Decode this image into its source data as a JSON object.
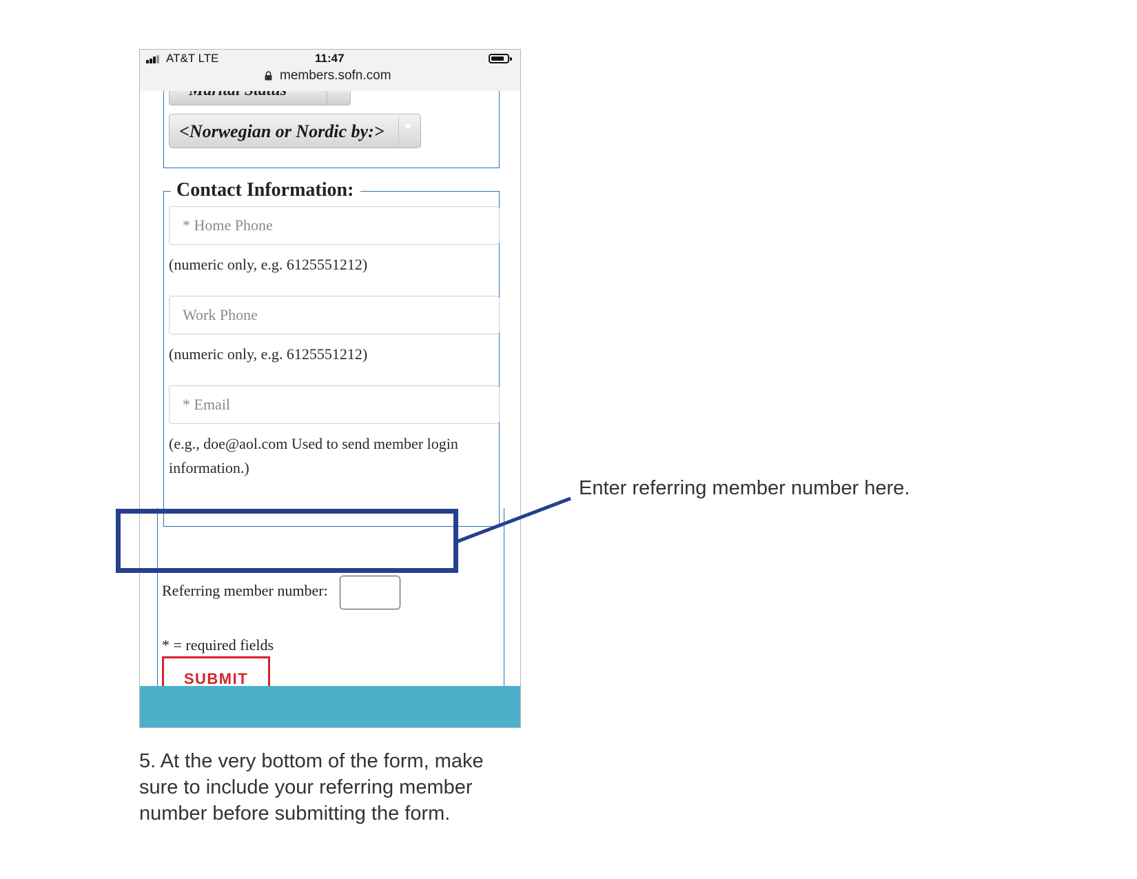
{
  "status_bar": {
    "carrier": "AT&T   LTE",
    "time": "11:47",
    "url": "members.sofn.com"
  },
  "form": {
    "marital_status_label": "Marital Status",
    "norwegian_select_value": "<Norwegian or Nordic by:>",
    "contact_legend": "Contact Information:",
    "home_phone_placeholder": "* Home Phone",
    "home_phone_hint": "(numeric only, e.g. 6125551212)",
    "work_phone_placeholder": "Work Phone",
    "work_phone_hint": "(numeric only, e.g. 6125551212)",
    "email_placeholder": "* Email",
    "email_hint": "(e.g., doe@aol.com Used to send member login information.)",
    "referring_label": "Referring member number:",
    "referring_value": "",
    "required_note": "* = required fields",
    "submit_label": "SUBMIT"
  },
  "annotation": {
    "callout": "Enter referring member number here.",
    "caption": "5. At the very bottom of the form, make sure to include your referring member number before submitting the form."
  },
  "colors": {
    "callout_blue": "#263f8e",
    "fieldset_blue": "#2f6fb0",
    "submit_red": "#d8232a",
    "footer_teal": "#4bb1ca"
  }
}
